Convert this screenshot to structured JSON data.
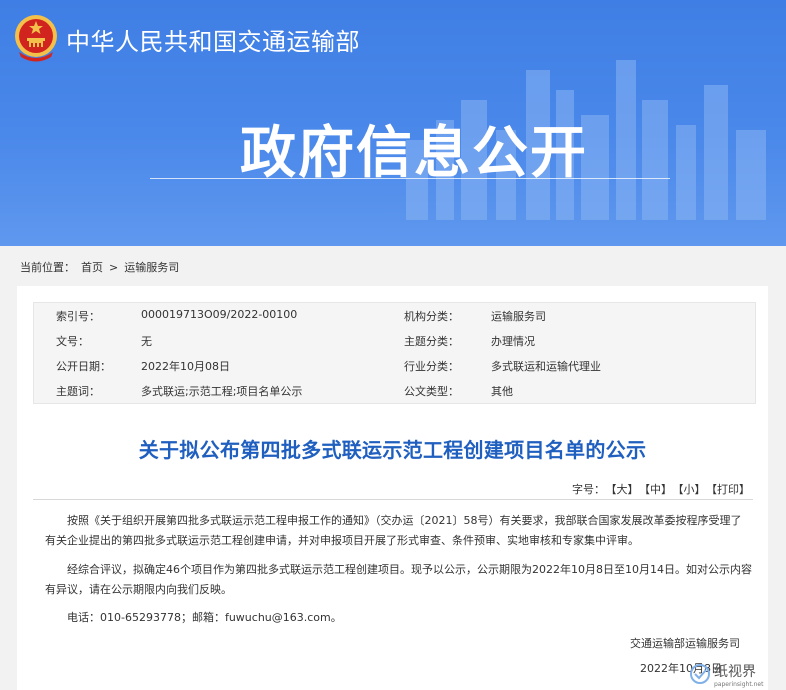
{
  "header": {
    "ministry_name": "中华人民共和国交通运输部",
    "banner_title": "政府信息公开"
  },
  "breadcrumb": {
    "label": "当前位置：",
    "home": "首页",
    "separator": ">",
    "current": "运输服务司"
  },
  "meta": {
    "rows": [
      {
        "k1": "索引号：",
        "v1": "000019713O09/2022-00100",
        "k2": "机构分类：",
        "v2": "运输服务司"
      },
      {
        "k1": "文号：",
        "v1": "无",
        "k2": "主题分类：",
        "v2": "办理情况"
      },
      {
        "k1": "公开日期：",
        "v1": "2022年10月08日",
        "k2": "行业分类：",
        "v2": "多式联运和运输代理业"
      },
      {
        "k1": "主题词：",
        "v1": "多式联运;示范工程;项目名单公示",
        "k2": "公文类型：",
        "v2": "其他"
      }
    ]
  },
  "article": {
    "title": "关于拟公布第四批多式联运示范工程创建项目名单的公示",
    "font_size_label": "字号：",
    "font_large": "【大】",
    "font_medium": "【中】",
    "font_small": "【小】",
    "print": "【打印】",
    "p1_line1": "按照《关于组织开展第四批多式联运示范工程申报工作的通知》（交办运〔2021〕58号）有关要求，我部联合国家发展改革委按程序受理了",
    "p1_line2": "有关企业提出的第四批多式联运示范工程创建申请，并对申报项目开展了形式审查、条件预审、实地审核和专家集中评审。",
    "p2_line1": "经综合评议，拟确定46个项目作为第四批多式联运示范工程创建项目。现予以公示，公示期限为2022年10月8日至10月14日。如对公示内容",
    "p2_line2": "有异议，请在公示期限内向我们反映。",
    "contact": "电话：010-65293778；邮箱：fuwuchu@163.com。",
    "signature": "交通运输部运输服务司",
    "date": "2022年10月8日"
  },
  "watermark": {
    "text": "纸视界",
    "subtext": "paperinsight.net"
  },
  "colors": {
    "banner": "#4a88ea",
    "title": "#1f5fbf",
    "emblem_red": "#d2241f",
    "emblem_gold": "#f3c04a"
  }
}
